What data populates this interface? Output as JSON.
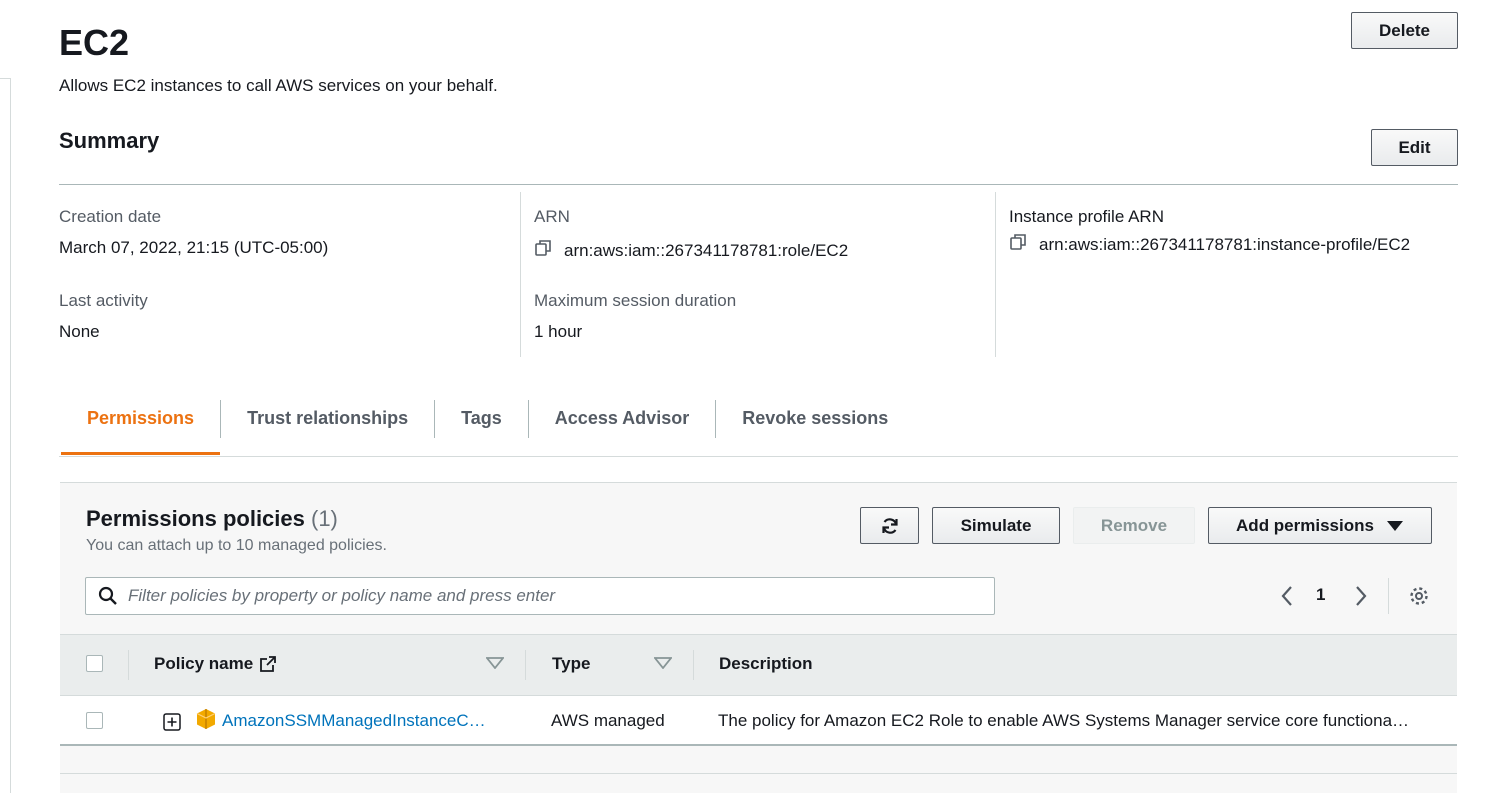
{
  "role": {
    "title": "EC2",
    "description": "Allows EC2 instances to call AWS services on your behalf.",
    "delete_label": "Delete"
  },
  "summary": {
    "heading": "Summary",
    "edit_label": "Edit",
    "creation_date_label": "Creation date",
    "creation_date_value": "March 07, 2022, 21:15 (UTC-05:00)",
    "last_activity_label": "Last activity",
    "last_activity_value": "None",
    "arn_label": "ARN",
    "arn_value": "arn:aws:iam::267341178781:role/EC2",
    "max_session_label": "Maximum session duration",
    "max_session_value": "1 hour",
    "instance_profile_label": "Instance profile ARN",
    "instance_profile_value": "arn:aws:iam::267341178781:instance-profile/EC2"
  },
  "tabs": [
    {
      "label": "Permissions",
      "active": true
    },
    {
      "label": "Trust relationships",
      "active": false
    },
    {
      "label": "Tags",
      "active": false
    },
    {
      "label": "Access Advisor",
      "active": false
    },
    {
      "label": "Revoke sessions",
      "active": false
    }
  ],
  "permissions": {
    "title": "Permissions policies",
    "count": "(1)",
    "description": "You can attach up to 10 managed policies.",
    "simulate_label": "Simulate",
    "remove_label": "Remove",
    "add_label": "Add permissions",
    "search_placeholder": "Filter policies by property or policy name and press enter",
    "page": "1",
    "columns": {
      "policy_name": "Policy name",
      "type": "Type",
      "description": "Description"
    },
    "rows": [
      {
        "policy_name": "AmazonSSMManagedInstanceC…",
        "type": "AWS managed",
        "description": "The policy for Amazon EC2 Role to enable AWS Systems Manager service core functiona…"
      }
    ]
  },
  "colors": {
    "accent": "#ec7211",
    "link": "#0073bb",
    "policy_icon": "#f2a900"
  },
  "icons": [
    "copy-icon",
    "refresh-icon",
    "caret-down-icon",
    "search-icon",
    "chevron-left-icon",
    "chevron-right-icon",
    "gear-icon",
    "external-link-icon",
    "sort-icon",
    "expand-icon",
    "aws-managed-policy-icon"
  ]
}
